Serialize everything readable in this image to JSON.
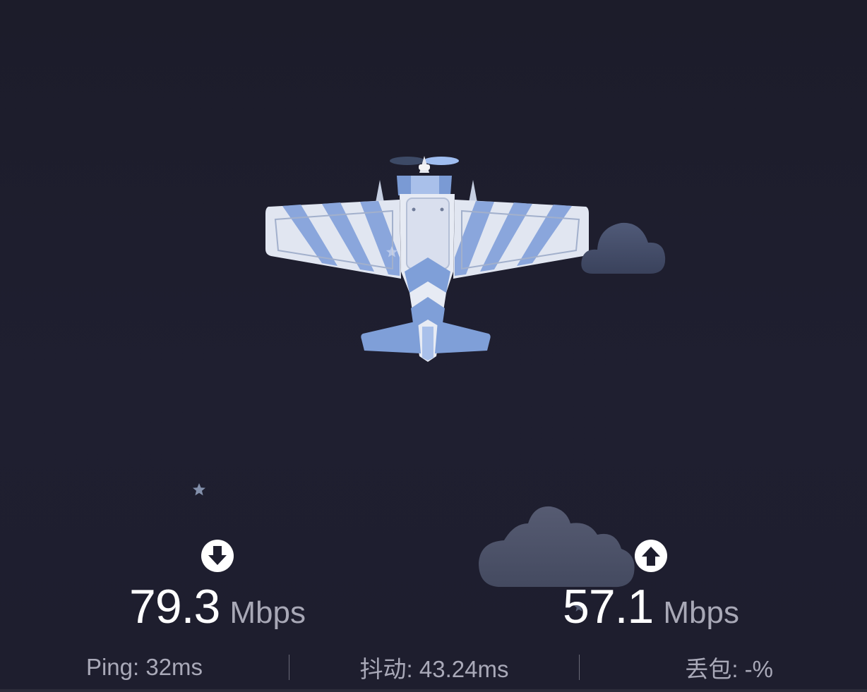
{
  "speed_test": {
    "download": {
      "icon": "arrow-down-circle-icon",
      "value": "79.3",
      "unit": "Mbps"
    },
    "upload": {
      "icon": "arrow-up-circle-icon",
      "value": "57.1",
      "unit": "Mbps"
    },
    "stats": {
      "ping": "Ping:  32ms",
      "jitter": "抖动:  43.24ms",
      "packet_loss": "丢包:  -%"
    }
  },
  "colors": {
    "background": "#1e1e2e",
    "value_text": "#ffffff",
    "unit_text": "#a8a8b6",
    "stat_text": "#a9a9b8",
    "plane_blue": "#7f9fd8",
    "plane_white": "#e3e8f3"
  }
}
